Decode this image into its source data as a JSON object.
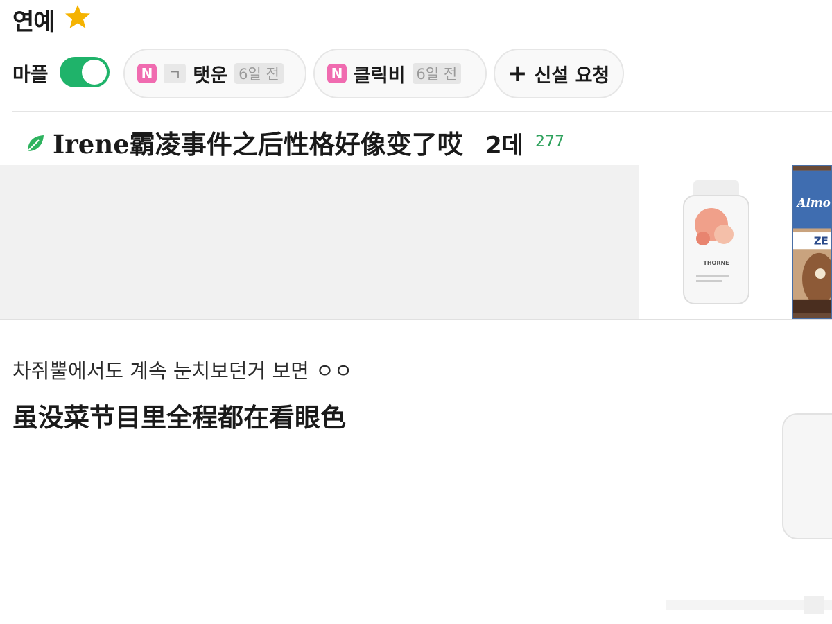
{
  "header": {
    "title": "연예",
    "star_icon": "star-icon",
    "star_color": "#f5b301"
  },
  "filters": {
    "mapl_label": "마플",
    "mapl_toggle_on": true,
    "toggle_color": "#1fb36a",
    "chips": [
      {
        "badge": "N",
        "tag": "ㄱ",
        "name": "탯운",
        "days": "6일 전"
      },
      {
        "badge": "N",
        "name": "클릭비",
        "days": "6일 전"
      }
    ],
    "request": {
      "icon": "plus-icon",
      "label": "신설 요청"
    }
  },
  "post": {
    "icon": "leaf-icon",
    "title": "Irene霸凌事件之后性格好像变了哎",
    "title_suffix": "2데",
    "count": "277",
    "count_color": "#2ea15c"
  },
  "ad": {
    "product1_brand": "THORNE",
    "product2_brand": "Almond Breeze",
    "product2_tag": "ZE"
  },
  "content": {
    "korean": "차쥐뿔에서도 계속 눈치보던거 보면 ㅇㅇ",
    "chinese": "虽没菜节目里全程都在看眼色"
  }
}
